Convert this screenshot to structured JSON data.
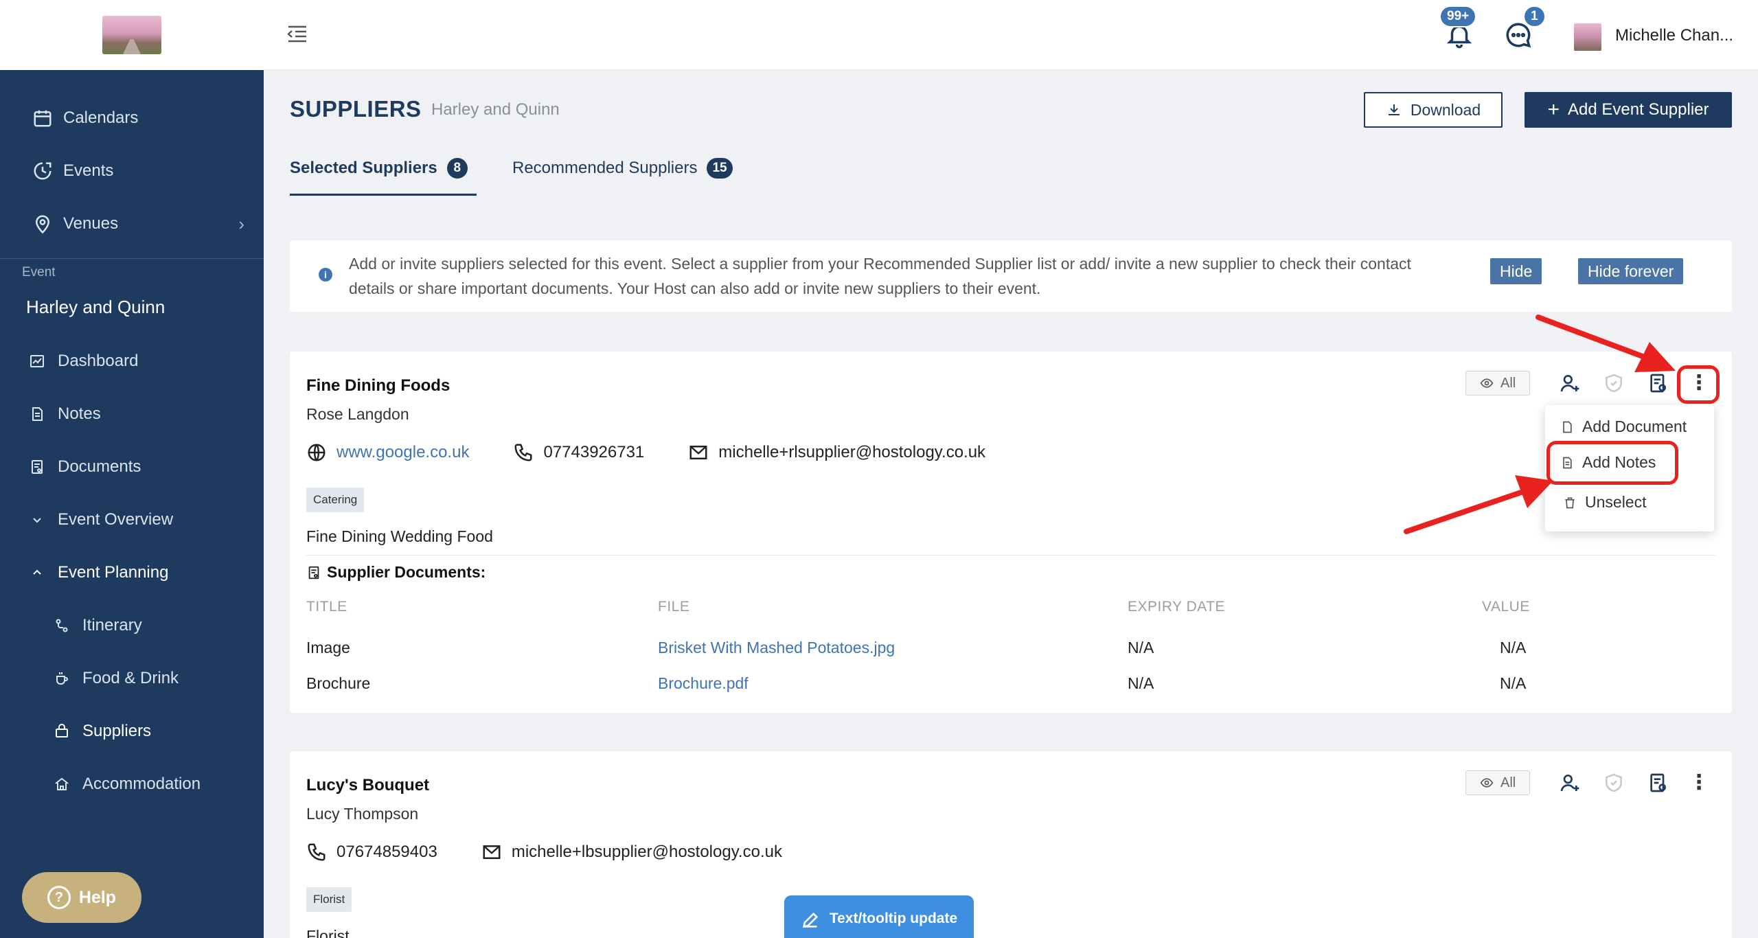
{
  "sidebar": {
    "nav": [
      {
        "label": "Calendars",
        "icon": "calendar-icon"
      },
      {
        "label": "Events",
        "icon": "events-clock-icon"
      },
      {
        "label": "Venues",
        "icon": "location-pin-icon"
      }
    ],
    "section_label": "Event",
    "event_name": "Harley and Quinn",
    "event_nav": [
      {
        "label": "Dashboard"
      },
      {
        "label": "Notes"
      },
      {
        "label": "Documents"
      },
      {
        "label": "Event Overview"
      },
      {
        "label": "Event Planning"
      }
    ],
    "planning_sub": [
      {
        "label": "Itinerary"
      },
      {
        "label": "Food & Drink"
      },
      {
        "label": "Suppliers"
      },
      {
        "label": "Accommodation"
      }
    ],
    "help_label": "Help",
    "help_glyph": "?"
  },
  "topbar": {
    "notifications_badge": "99+",
    "messages_badge": "1",
    "user_name": "Michelle Chan..."
  },
  "page": {
    "title": "SUPPLIERS",
    "subtitle": "Harley and Quinn",
    "download_label": "Download",
    "add_supplier_label": "Add Event Supplier"
  },
  "tabs": [
    {
      "label": "Selected Suppliers",
      "count": "8"
    },
    {
      "label": "Recommended Suppliers",
      "count": "15"
    }
  ],
  "banner": {
    "icon_glyph": "i",
    "text": "Add or invite suppliers selected for this event. Select a supplier from your Recommended Supplier list or add/ invite a new supplier to check their contact details or share important documents. Your Host can also add or invite new suppliers to their event.",
    "hide_label": "Hide",
    "hide_forever_label": "Hide forever"
  },
  "suppliers": [
    {
      "name": "Fine Dining Foods",
      "contact": "Rose Langdon",
      "website": "www.google.co.uk",
      "phone": "07743926731",
      "email": "michelle+rlsupplier@hostology.co.uk",
      "tag": "Catering",
      "description": "Fine Dining Wedding Food",
      "visibility_label": "All",
      "documents_title": "Supplier Documents:",
      "doc_headers": [
        "TITLE",
        "FILE",
        "EXPIRY DATE",
        "VALUE"
      ],
      "documents": [
        {
          "title": "Image",
          "file": "Brisket With Mashed Potatoes.jpg",
          "expiry": "N/A",
          "value": "N/A"
        },
        {
          "title": "Brochure",
          "file": "Brochure.pdf",
          "expiry": "N/A",
          "value": "N/A"
        }
      ]
    },
    {
      "name": "Lucy's Bouquet",
      "contact": "Lucy Thompson",
      "phone": "07674859403",
      "email": "michelle+lbsupplier@hostology.co.uk",
      "tag": "Florist",
      "description": "Florist",
      "visibility_label": "All"
    }
  ],
  "dropdown": {
    "items": [
      "Add Document",
      "Add Notes",
      "Unselect"
    ]
  },
  "floating": {
    "label": "Text/tooltip update"
  },
  "colors": {
    "sidebar": "#1e3a5f",
    "accent": "#3e74b4",
    "annotation": "#e8231f",
    "help": "#c7b17d"
  }
}
